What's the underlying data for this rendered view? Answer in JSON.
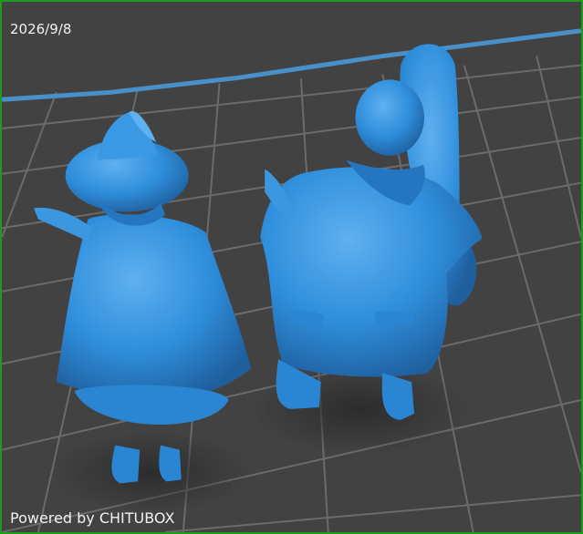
{
  "viewport": {
    "date_label": "2026/9/8",
    "brand_label": "Powered by CHITUBOX"
  },
  "scene": {
    "models": [
      {
        "name": "witch-figure"
      },
      {
        "name": "seated-figure-with-instrument"
      }
    ]
  },
  "colors": {
    "frame": "#1e9a1e",
    "background": "#424242",
    "grid": "#6b6b6b",
    "model": "#2f8fdc",
    "model_highlight": "#5fb0ef",
    "model_shadow": "#1f5f9e",
    "plate_edge": "#4a90c8"
  }
}
